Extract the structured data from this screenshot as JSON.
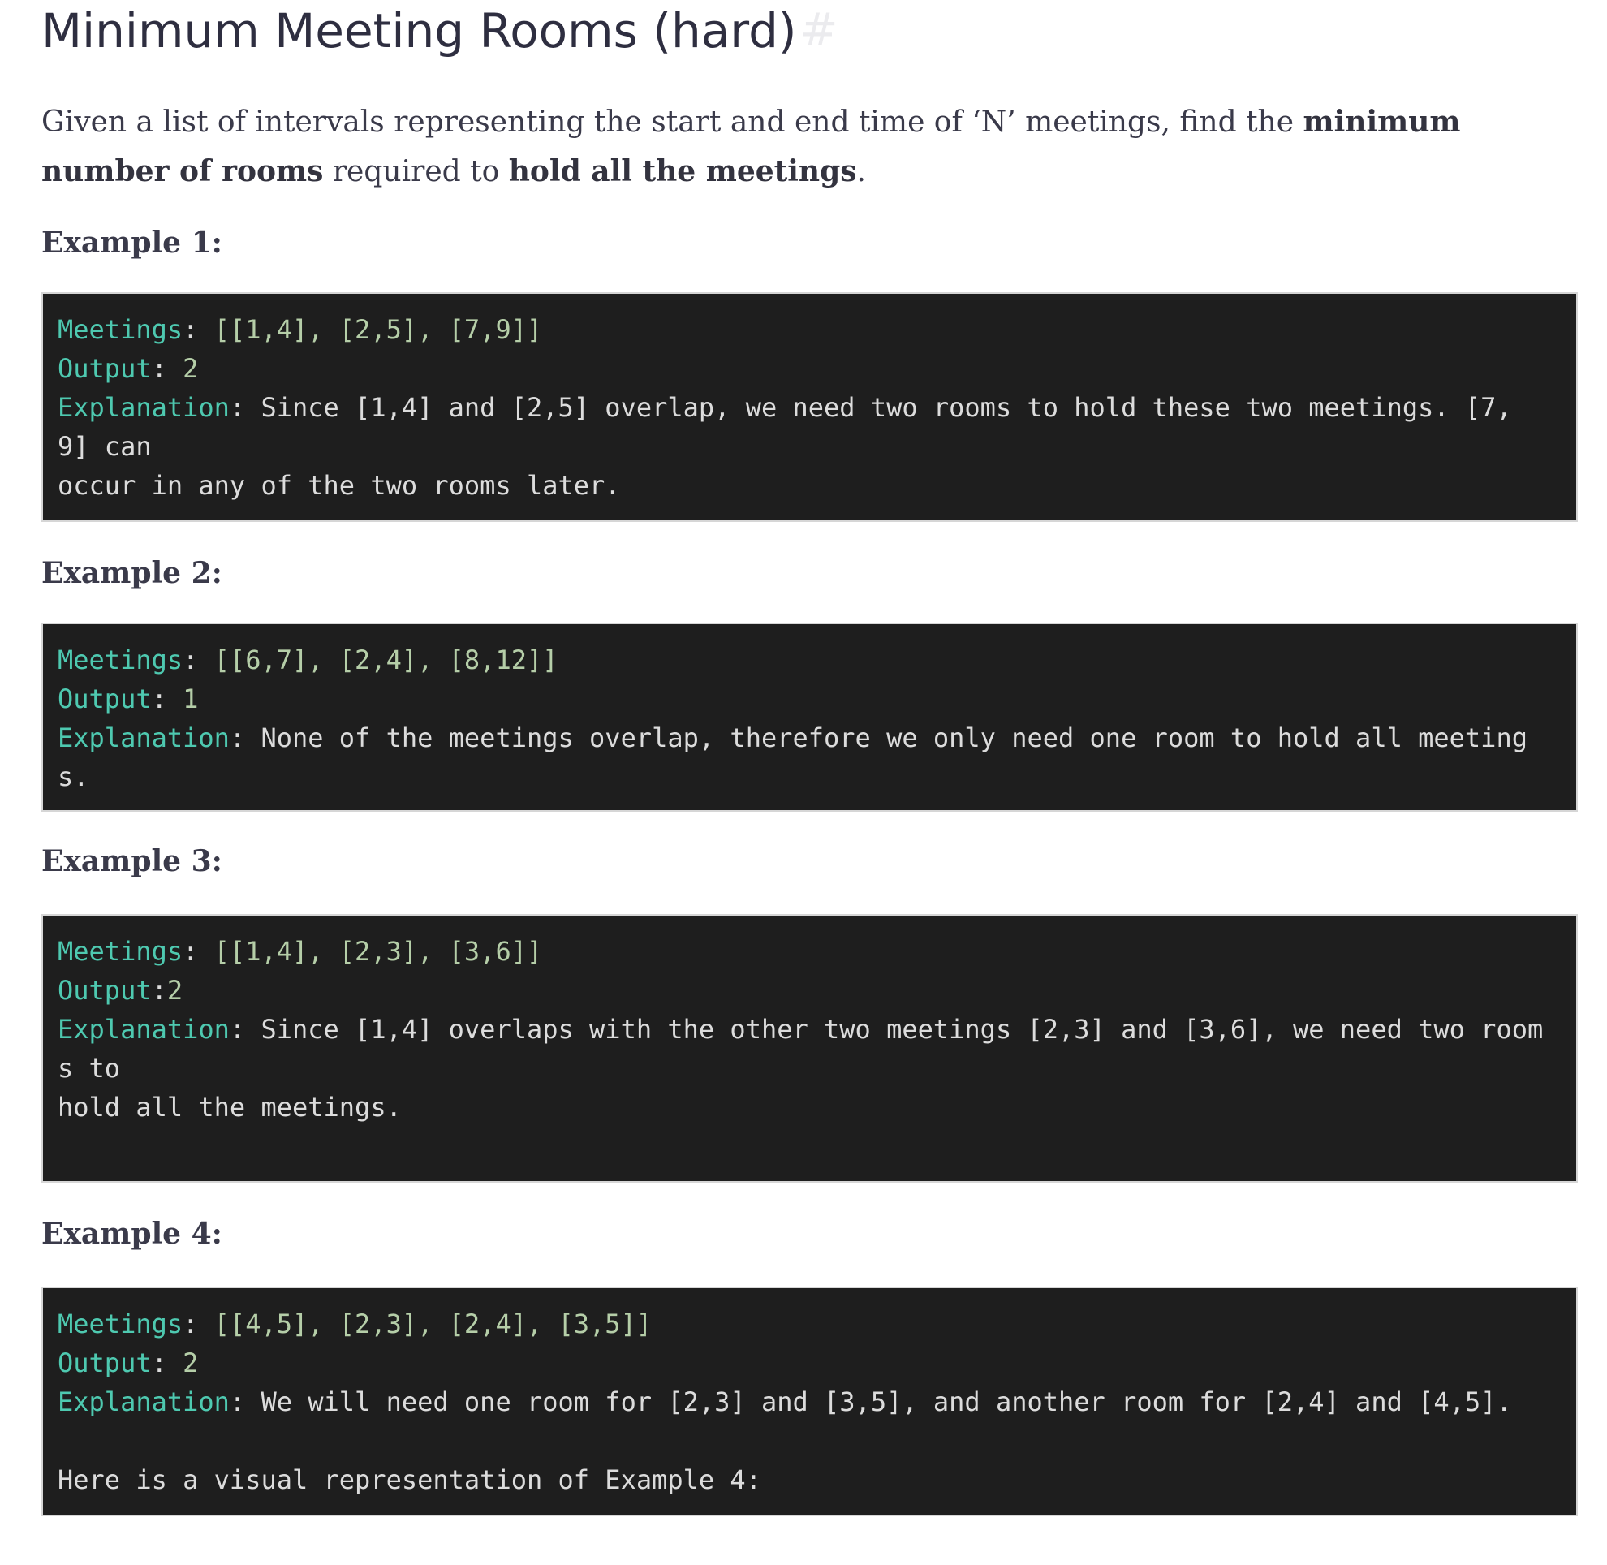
{
  "title": "Minimum Meeting Rooms (hard)",
  "anchor_symbol": "#",
  "intro": {
    "p1": "Given a list of intervals representing the start and end time of ‘N’ meetings, find the ",
    "b1": "minimum number of rooms",
    "p2": " required to ",
    "b2": "hold all the meetings",
    "p3": "."
  },
  "examples": [
    {
      "heading": "Example 1:",
      "meetings_label": "Meetings",
      "meetings_value": "[[1,4], [2,5], [7,9]]",
      "output_label": "Output",
      "output_value": "2",
      "explanation_label": "Explanation",
      "explanation_lines": [
        "Since [1,4] and [2,5] overlap, we need two rooms to hold these two meetings. [7,",
        "9] can",
        "occur in any of the two rooms later."
      ]
    },
    {
      "heading": "Example 2:",
      "meetings_label": "Meetings",
      "meetings_value": "[[6,7], [2,4], [8,12]]",
      "output_label": "Output",
      "output_value": "1",
      "explanation_label": "Explanation",
      "explanation_lines": [
        "None of the meetings overlap, therefore we only need one room to hold all meeting",
        "s."
      ]
    },
    {
      "heading": "Example 3:",
      "meetings_label": "Meetings",
      "meetings_value": "[[1,4], [2,3], [3,6]]",
      "output_label": "Output",
      "output_value": "2",
      "explanation_label": "Explanation",
      "explanation_lines": [
        "Since [1,4] overlaps with the other two meetings [2,3] and [3,6], we need two room",
        "s to",
        "hold all the meetings."
      ]
    },
    {
      "heading": "Example 4:",
      "meetings_label": "Meetings",
      "meetings_value": "[[4,5], [2,3], [2,4], [3,5]]",
      "output_label": "Output",
      "output_value": "2",
      "explanation_label": "Explanation",
      "explanation_lines": [
        "We will need one room for [2,3] and [3,5], and another room for [2,4] and [4,5]."
      ],
      "note": "Here is a visual representation of Example 4:"
    }
  ]
}
